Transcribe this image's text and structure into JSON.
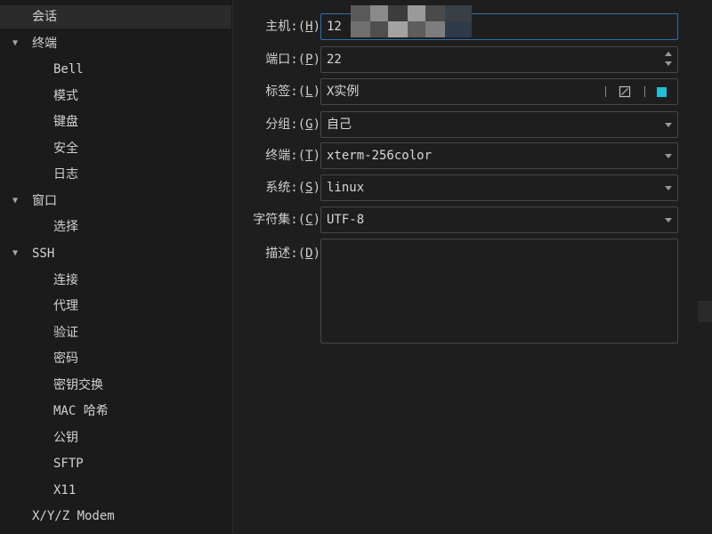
{
  "sidebar": {
    "items": [
      {
        "label": "会话",
        "level": 0,
        "selected": true
      },
      {
        "label": "终端",
        "level": 0,
        "expanded": true
      },
      {
        "label": "Bell",
        "level": 1
      },
      {
        "label": "模式",
        "level": 1
      },
      {
        "label": "键盘",
        "level": 1
      },
      {
        "label": "安全",
        "level": 1
      },
      {
        "label": "日志",
        "level": 1
      },
      {
        "label": "窗口",
        "level": 0,
        "expanded": true
      },
      {
        "label": "选择",
        "level": 1
      },
      {
        "label": "SSH",
        "level": 0,
        "expanded": true
      },
      {
        "label": "连接",
        "level": 1
      },
      {
        "label": "代理",
        "level": 1
      },
      {
        "label": "验证",
        "level": 1
      },
      {
        "label": "密码",
        "level": 1
      },
      {
        "label": "密钥交换",
        "level": 1
      },
      {
        "label": "MAC 哈希",
        "level": 1
      },
      {
        "label": "公钥",
        "level": 1
      },
      {
        "label": "SFTP",
        "level": 1
      },
      {
        "label": "X11",
        "level": 1
      },
      {
        "label": "X/Y/Z Modem",
        "level": 0
      }
    ]
  },
  "form": {
    "host": {
      "label_pre": "主机:(",
      "mnemonic": "H",
      "label_post": ")",
      "value": "12"
    },
    "port": {
      "label_pre": "端口:(",
      "mnemonic": "P",
      "label_post": ")",
      "value": "22"
    },
    "tag": {
      "label_pre": "标签:(",
      "mnemonic": "L",
      "label_post": ")",
      "value": "X实例",
      "color": "#1ec2d6"
    },
    "group": {
      "label_pre": "分组:(",
      "mnemonic": "G",
      "label_post": ")",
      "value": "自己"
    },
    "terminal": {
      "label_pre": "终端:(",
      "mnemonic": "T",
      "label_post": ")",
      "value": "xterm-256color"
    },
    "system": {
      "label_pre": "系统:(",
      "mnemonic": "S",
      "label_post": ")",
      "value": "linux"
    },
    "charset": {
      "label_pre": "字符集:(",
      "mnemonic": "C",
      "label_post": ")",
      "value": "UTF-8"
    },
    "description": {
      "label_pre": "描述:(",
      "mnemonic": "D",
      "label_post": ")",
      "value": ""
    }
  },
  "icons": {
    "expand": "triangle-down-icon",
    "dropdown": "chevron-down-icon",
    "spinner": "spin-arrows-icon",
    "edit": "edit-icon",
    "color": "color-swatch-icon"
  },
  "colors": {
    "accent_focus": "#2f6fa7",
    "tag_color": "#1ec2d6"
  }
}
